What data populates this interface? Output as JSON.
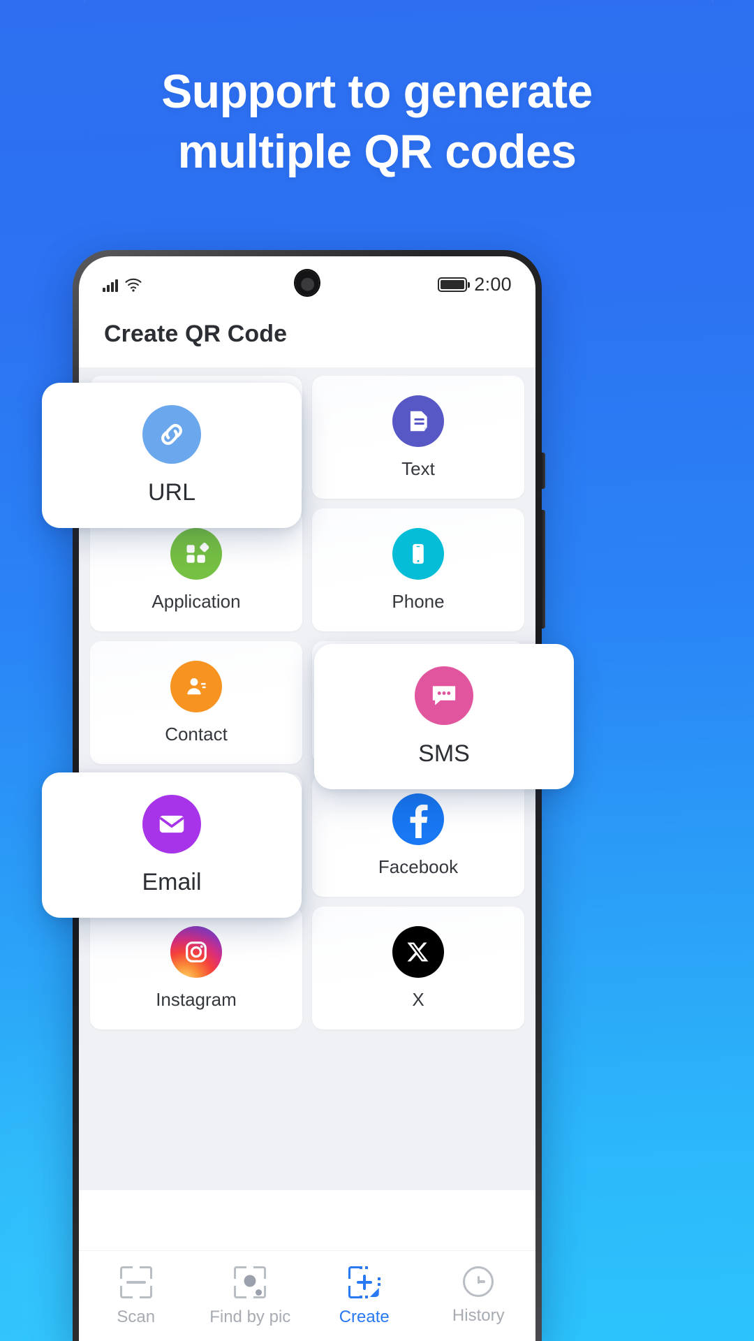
{
  "promo": {
    "headline_line1": "Support to generate",
    "headline_line2": "multiple QR codes",
    "background_color": "#2A86F6"
  },
  "phone": {
    "status_bar": {
      "signal_icon": "signal-bars-icon",
      "wifi_icon": "wifi-icon",
      "camera_icon": "punch-hole-camera",
      "battery_icon": "battery-full-icon",
      "time": "2:00"
    },
    "header": {
      "title": "Create QR Code"
    },
    "grid": {
      "items": [
        {
          "label": "URL",
          "icon": "link-icon",
          "color": "#6BA7EC",
          "floating": true
        },
        {
          "label": "Text",
          "icon": "document-icon",
          "color": "#5857C6",
          "floating": false
        },
        {
          "label": "Application",
          "icon": "apps-grid-icon",
          "color": "#76C043",
          "floating": false
        },
        {
          "label": "Phone",
          "icon": "smartphone-icon",
          "color": "#06BDD8",
          "floating": false
        },
        {
          "label": "Contact",
          "icon": "contact-person-icon",
          "color": "#F79421",
          "floating": false
        },
        {
          "label": "SMS",
          "icon": "chat-bubble-icon",
          "color": "#E0559E",
          "floating": true
        },
        {
          "label": "Email",
          "icon": "envelope-icon",
          "color": "#A734E9",
          "floating": true
        },
        {
          "label": "Facebook",
          "icon": "facebook-icon",
          "color": "#1877F2",
          "floating": false
        },
        {
          "label": "Instagram",
          "icon": "instagram-icon",
          "color": "#D6249F",
          "floating": false
        },
        {
          "label": "X",
          "icon": "x-twitter-icon",
          "color": "#000000",
          "floating": false
        }
      ]
    },
    "bottom_nav": {
      "active_color": "#2979F2",
      "inactive_color": "#A7ABB2",
      "items": [
        {
          "label": "Scan",
          "icon": "scan-frame-icon",
          "active": false
        },
        {
          "label": "Find by pic",
          "icon": "image-scan-icon",
          "active": false
        },
        {
          "label": "Create",
          "icon": "create-qr-icon",
          "active": true
        },
        {
          "label": "History",
          "icon": "clock-history-icon",
          "active": false
        }
      ]
    }
  }
}
